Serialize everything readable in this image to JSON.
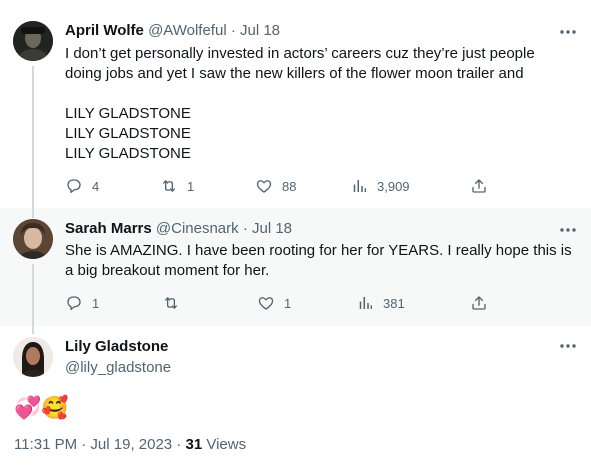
{
  "tweet1": {
    "name": "April Wolfe",
    "handle": "@AWolfeful",
    "sep": " · ",
    "date": "Jul 18",
    "text_lines": [
      "I don’t get personally invested in actors’ careers cuz they’re just people",
      "doing jobs and yet I saw the new killers of the flower moon trailer and",
      "",
      "LILY GLADSTONE",
      "LILY GLADSTONE",
      "LILY GLADSTONE"
    ],
    "replies": "4",
    "retweets": "1",
    "likes": "88",
    "views": "3,909"
  },
  "tweet2": {
    "name": "Sarah Marrs",
    "handle": "@Cinesnark",
    "sep": " · ",
    "date": "Jul 18",
    "text_lines": [
      "She is AMAZING. I have been rooting for her for YEARS. I really hope this is",
      "a big breakout moment for her."
    ],
    "replies": "1",
    "retweets": "",
    "likes": "1",
    "views": "381"
  },
  "tweet3": {
    "name": "Lily Gladstone",
    "handle": "@lily_gladstone",
    "emoji": "💞🥰",
    "time": "11:31 PM · Jul 19, 2023",
    "dot": " · ",
    "views_count": "31",
    "views_label": " Views"
  },
  "icons": [
    "more-icon",
    "reply-icon",
    "retweet-icon",
    "like-icon",
    "views-icon",
    "share-icon"
  ],
  "colors": {
    "text": "#0f1419",
    "muted": "#536471",
    "thread_line": "#cfd9de",
    "hover_bg": "#f7f9f9"
  }
}
